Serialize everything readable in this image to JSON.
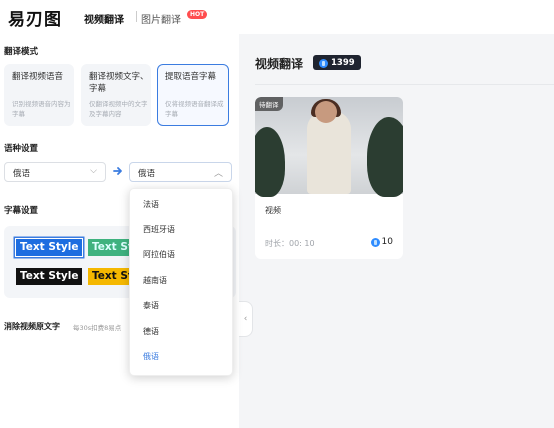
{
  "header": {
    "logo": "易刃图",
    "tabs": [
      {
        "label": "视频翻译",
        "active": true
      },
      {
        "label": "图片翻译",
        "badge": "HOT"
      }
    ]
  },
  "left": {
    "translate_mode_title": "翻译模式",
    "modes": [
      {
        "title": "翻译视频语音",
        "desc": "识别视频语音内容为字幕",
        "active": false
      },
      {
        "title": "翻译视频文字、字幕",
        "desc": "仅翻译视频中的文字及字幕内容",
        "active": false
      },
      {
        "title": "提取语音字幕",
        "desc": "仅将视频语音翻译成字幕",
        "active": true
      }
    ],
    "language_title": "语种设置",
    "source_language": "俄语",
    "target_language": "俄语",
    "subtitle_title": "字幕设置",
    "subtitle_styles": [
      "Text Style",
      "Text Sty",
      "Text Style",
      "Text Sty"
    ],
    "remove_label": "消除视频原文字",
    "remove_hint": "每30s扣费8易点"
  },
  "dropdown": {
    "options": [
      "法语",
      "西班牙语",
      "阿拉伯语",
      "越南语",
      "泰语",
      "德语",
      "俄语"
    ],
    "selected_index": 6
  },
  "right": {
    "title": "视频翻译",
    "credits": "1399",
    "card": {
      "status": "待翻译",
      "title": "视频",
      "duration": "时长：00: 10",
      "cost": "10"
    }
  },
  "colors": {
    "accent": "#3b7ce0",
    "hot": "#ff4d4f",
    "badge_bg": "#1f2430"
  }
}
